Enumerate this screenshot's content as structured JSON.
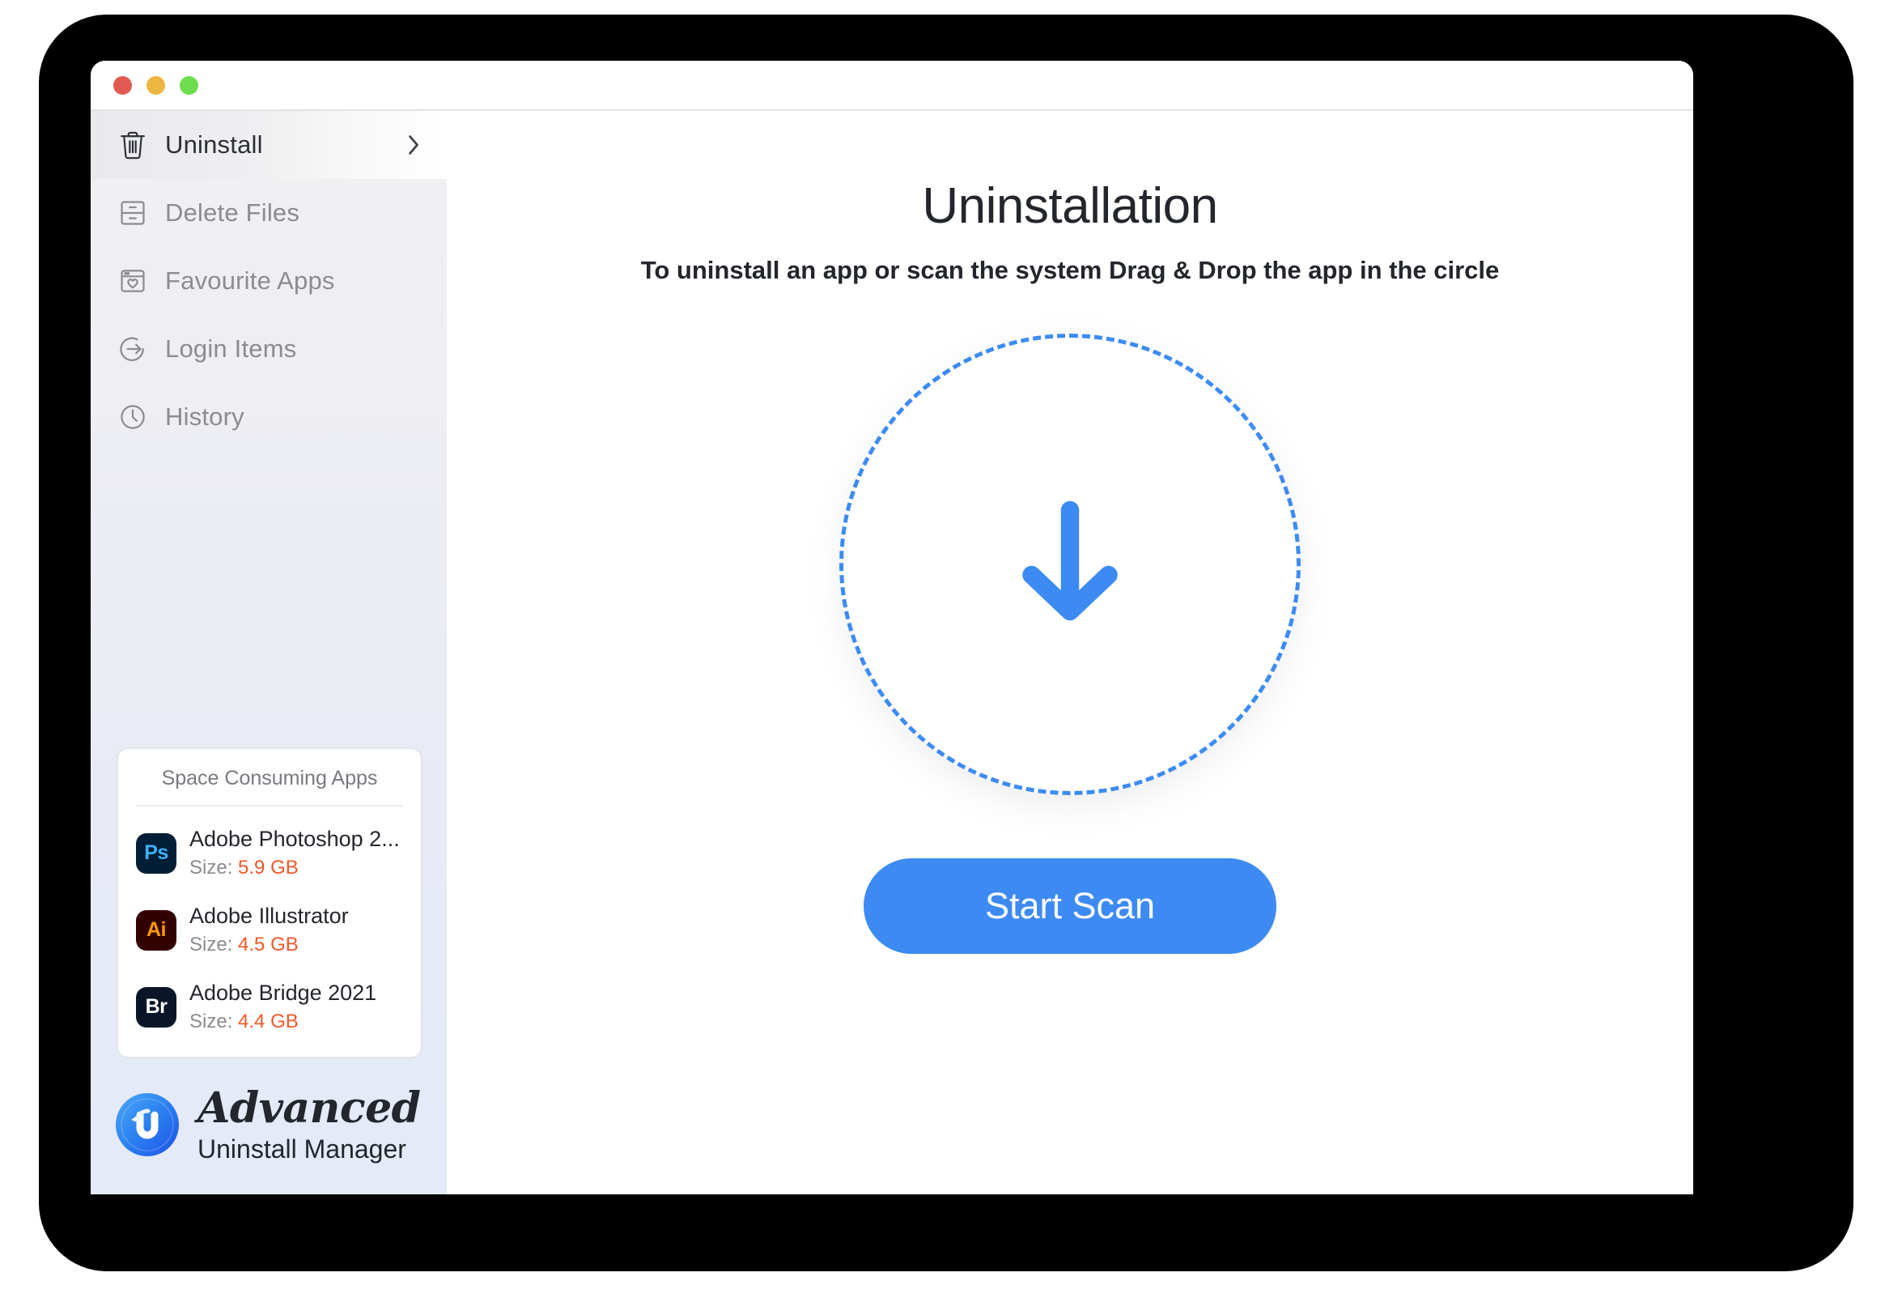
{
  "window": {
    "traffic_lights": [
      {
        "name": "close",
        "color": "#e05a52"
      },
      {
        "name": "minimize",
        "color": "#ecb740"
      },
      {
        "name": "maximize",
        "color": "#6ddd4e"
      }
    ]
  },
  "sidebar": {
    "items": [
      {
        "label": "Uninstall",
        "icon": "trash-icon",
        "selected": true,
        "chevron": "›"
      },
      {
        "label": "Delete Files",
        "icon": "drawer-icon",
        "selected": false
      },
      {
        "label": "Favourite Apps",
        "icon": "heart-window-icon",
        "selected": false
      },
      {
        "label": "Login Items",
        "icon": "login-arrow-icon",
        "selected": false
      },
      {
        "label": "History",
        "icon": "clock-icon",
        "selected": false
      }
    ],
    "space_consuming_apps": {
      "title": "Space Consuming Apps",
      "size_label": "Size:",
      "apps": [
        {
          "name": "Adobe Photoshop 2...",
          "size": "5.9 GB",
          "badge": "Ps",
          "bg": "#001e36",
          "fg": "#3db1ff"
        },
        {
          "name": "Adobe Illustrator",
          "size": "4.5 GB",
          "badge": "Ai",
          "bg": "#330000",
          "fg": "#ff9a00"
        },
        {
          "name": "Adobe Bridge 2021",
          "size": "4.4 GB",
          "badge": "Br",
          "bg": "#0a1628",
          "fg": "#ffffff"
        }
      ]
    },
    "brand": {
      "name": "Advanced",
      "subtitle": "Uninstall Manager",
      "logo": "advanced-uninstall-manager-logo"
    }
  },
  "main": {
    "title": "Uninstallation",
    "subtitle": "To uninstall an app or scan the system Drag & Drop the app in the circle",
    "dropzone": {
      "icon": "download-arrow-icon"
    },
    "start_scan_label": "Start Scan"
  },
  "colors": {
    "accent_blue": "#3d8bf2",
    "size_orange": "#f1592a",
    "text_dark": "#23262c",
    "text_muted": "#8b8b91"
  }
}
